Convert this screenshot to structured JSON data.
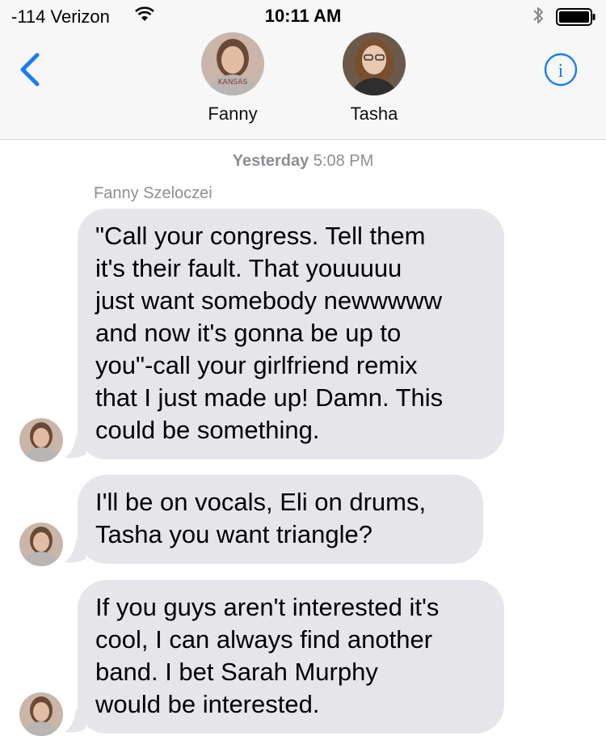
{
  "status_bar": {
    "carrier": "-114 Verizon",
    "time": "10:11 AM"
  },
  "nav": {
    "contacts": [
      {
        "name": "Fanny"
      },
      {
        "name": "Tasha"
      }
    ],
    "icons": {
      "back": "chevron-left-icon",
      "info": "info-icon"
    },
    "accent_color": "#1a7cf5"
  },
  "thread": {
    "timestamp_day": "Yesterday",
    "timestamp_time": "5:08 PM",
    "sender_name": "Fanny Szeloczei",
    "messages": [
      {
        "lines": [
          "\"Call your congress. Tell them",
          "it's their fault. That youuuuu",
          "just want somebody newwwww",
          "and now it's gonna be up to",
          "you\"-call your girlfriend remix",
          "that I just made up! Damn. This",
          "could be something."
        ]
      },
      {
        "lines": [
          "I'll be on vocals, Eli on drums,",
          "Tasha you want triangle?"
        ]
      },
      {
        "lines": [
          "If you guys aren't interested it's",
          "cool, I can always find another",
          "band. I bet Sarah Murphy",
          "would be interested."
        ]
      }
    ]
  }
}
